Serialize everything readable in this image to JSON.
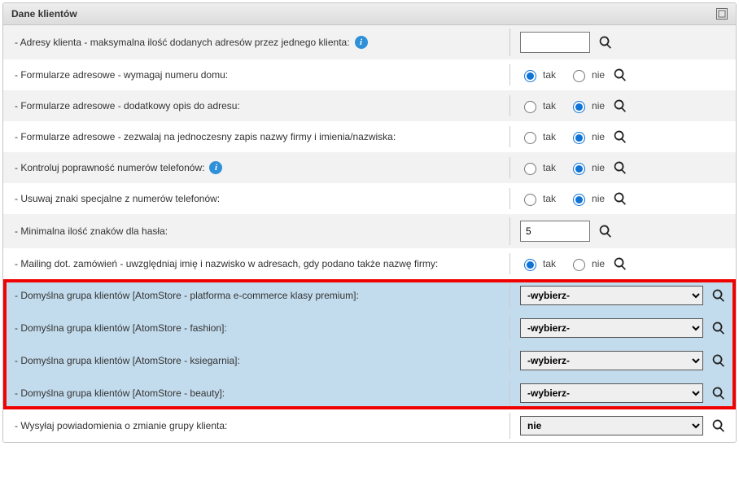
{
  "panel": {
    "title": "Dane klientów"
  },
  "labels": {
    "yes": "tak",
    "no": "nie",
    "select_placeholder": "-wybierz-"
  },
  "rows": {
    "r1": "- Adresy klienta - maksymalna ilość dodanych adresów przez jednego klienta:",
    "r2": "- Formularze adresowe - wymagaj numeru domu:",
    "r3": "- Formularze adresowe - dodatkowy opis do adresu:",
    "r4": "- Formularze adresowe - zezwalaj na jednoczesny zapis nazwy firmy i imienia/nazwiska:",
    "r5": "- Kontroluj poprawność numerów telefonów:",
    "r6": "- Usuwaj znaki specjalne z numerów telefonów:",
    "r7": "- Minimalna ilość znaków dla hasła:",
    "r7_value": "5",
    "r8": "- Mailing dot. zamówień - uwzględniaj imię i nazwisko w adresach, gdy podano także nazwę firmy:",
    "r9": "- Domyślna grupa klientów [AtomStore - platforma e-commerce klasy premium]:",
    "r10": "- Domyślna grupa klientów [AtomStore - fashion]:",
    "r11": "- Domyślna grupa klientów [AtomStore - ksiegarnia]:",
    "r12": "- Domyślna grupa klientów [AtomStore - beauty]:",
    "r13": "- Wysyłaj powiadomienia o zmianie grupy klienta:",
    "r13_selected": "nie"
  }
}
